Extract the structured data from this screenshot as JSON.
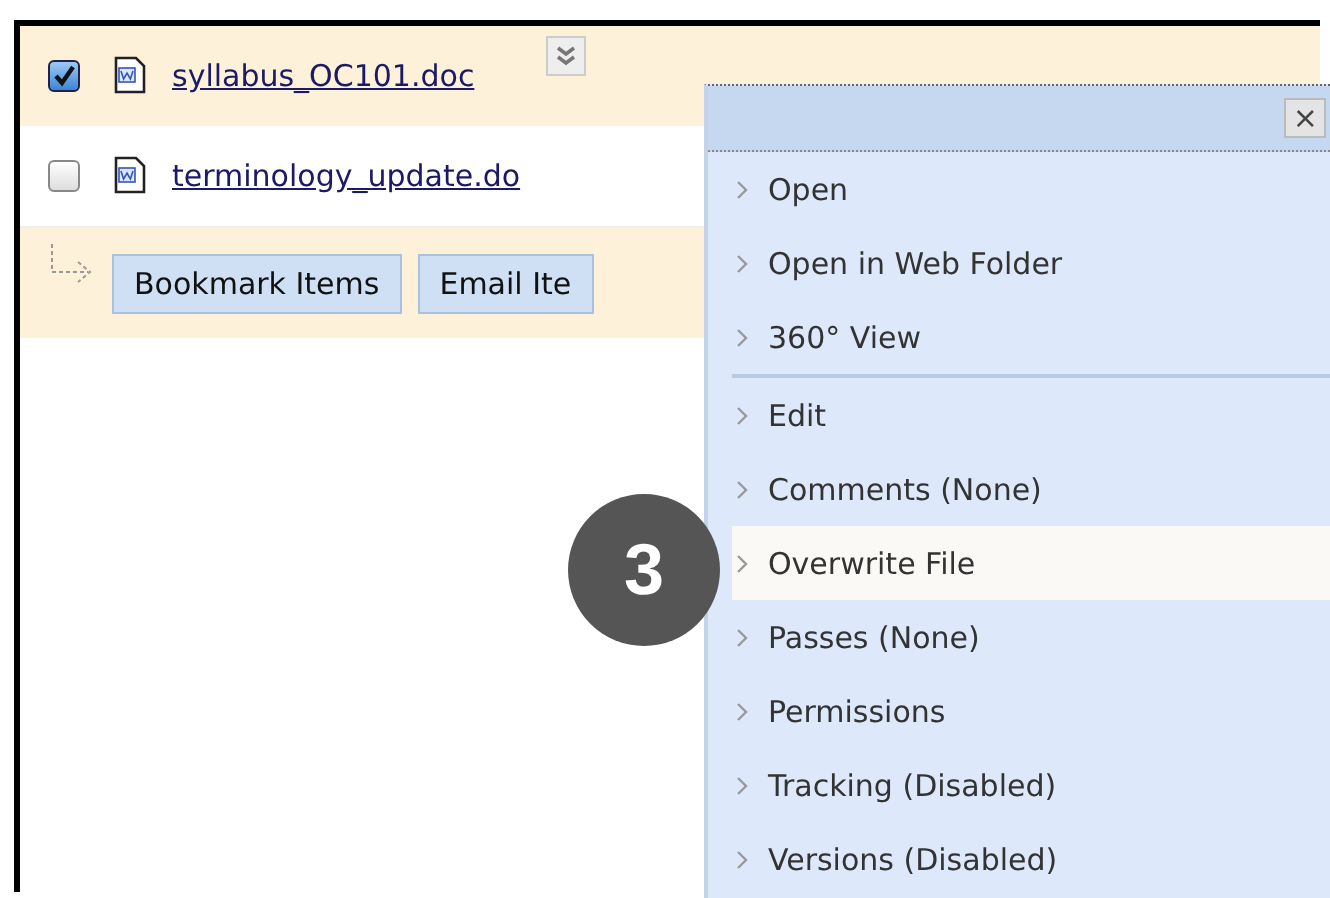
{
  "files": [
    {
      "name": "syllabus_OC101.doc",
      "checked": true
    },
    {
      "name": "terminology_update.do",
      "checked": false
    }
  ],
  "actions": [
    "Bookmark Items",
    "Email Ite"
  ],
  "menu": {
    "groups": [
      [
        {
          "label": "Open",
          "selected": false
        },
        {
          "label": "Open in Web Folder",
          "selected": false
        },
        {
          "label": "360° View",
          "selected": false
        }
      ],
      [
        {
          "label": "Edit",
          "selected": false
        },
        {
          "label": "Comments (None)",
          "selected": false
        },
        {
          "label": "Overwrite File",
          "selected": true
        },
        {
          "label": "Passes (None)",
          "selected": false
        },
        {
          "label": "Permissions",
          "selected": false
        },
        {
          "label": "Tracking (Disabled)",
          "selected": false
        },
        {
          "label": "Versions (Disabled)",
          "selected": false
        }
      ]
    ],
    "close": "×"
  },
  "callout": "3"
}
